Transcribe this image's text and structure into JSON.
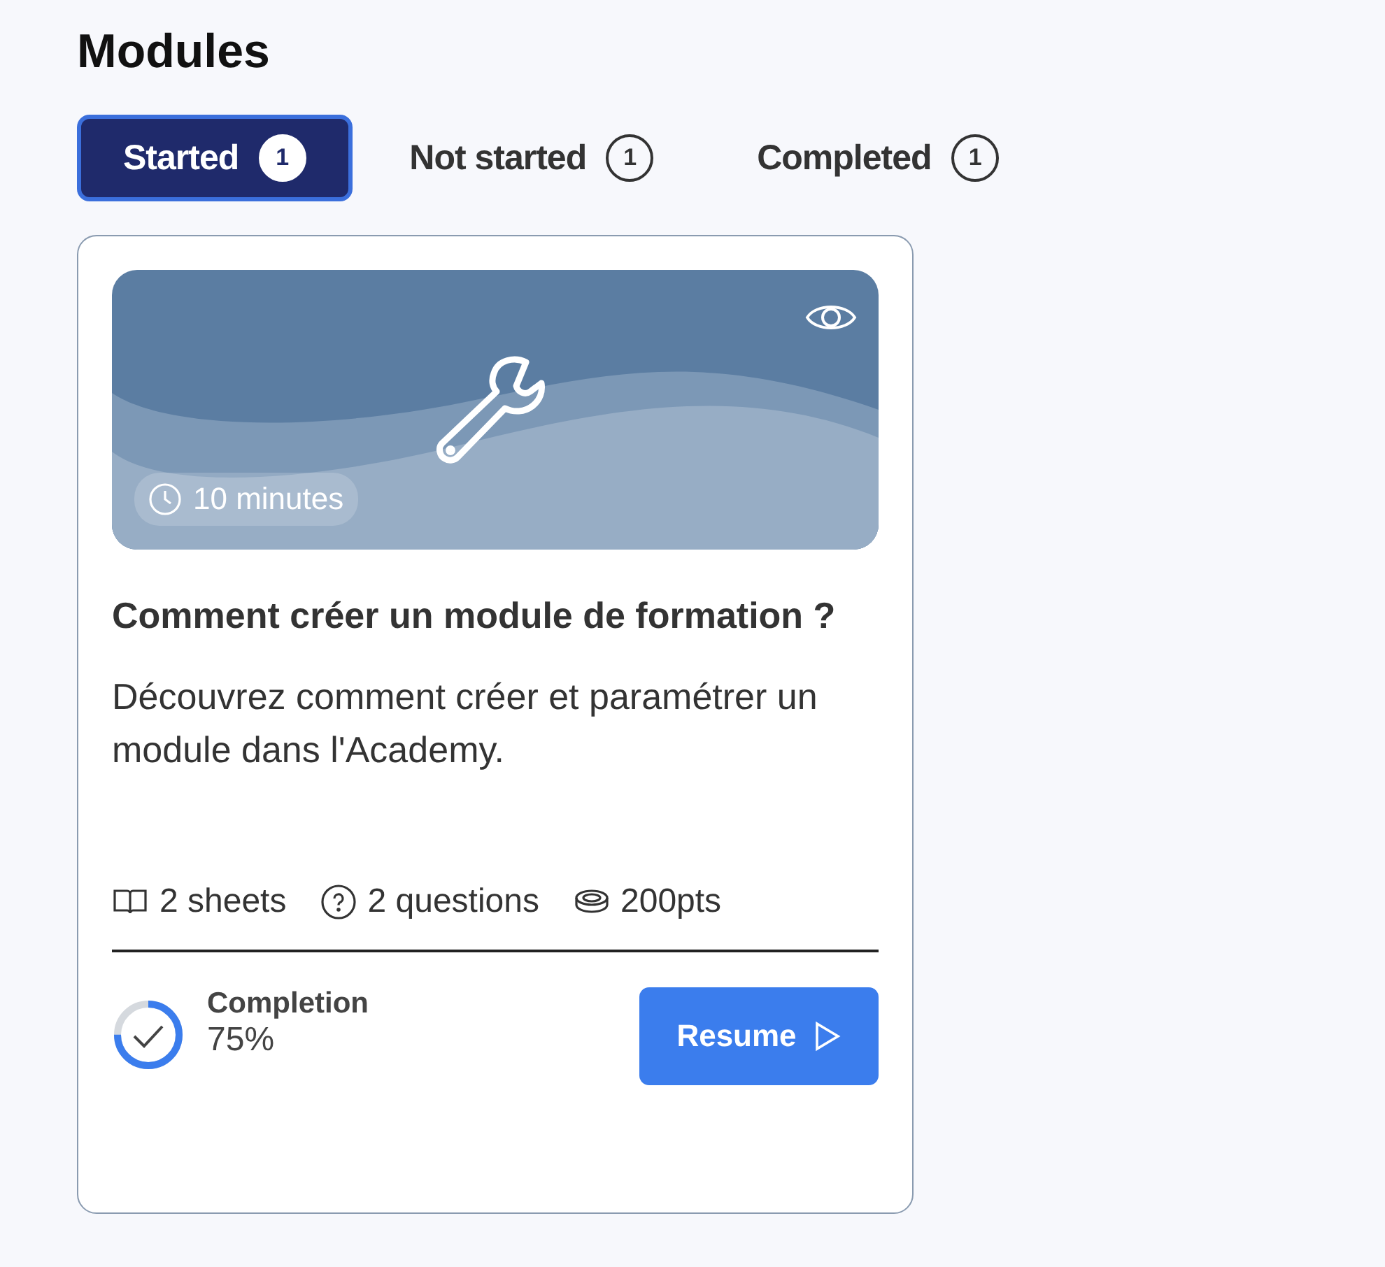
{
  "heading": "Modules",
  "tabs": [
    {
      "label": "Started",
      "count": "1",
      "selected": true
    },
    {
      "label": "Not started",
      "count": "1",
      "selected": false
    },
    {
      "label": "Completed",
      "count": "1",
      "selected": false
    }
  ],
  "card": {
    "duration": "10 minutes",
    "title": "Comment créer un module de formation ?",
    "description": "Découvrez comment créer et paramétrer un module dans l'Academy.",
    "stats": [
      {
        "kind": "sheets",
        "text": "2 sheets"
      },
      {
        "kind": "questions",
        "text": "2 questions"
      },
      {
        "kind": "points",
        "text": "200pts"
      }
    ],
    "completion": {
      "label": "Completion",
      "value": "75%",
      "level": 0.75
    },
    "button": "Resume"
  }
}
